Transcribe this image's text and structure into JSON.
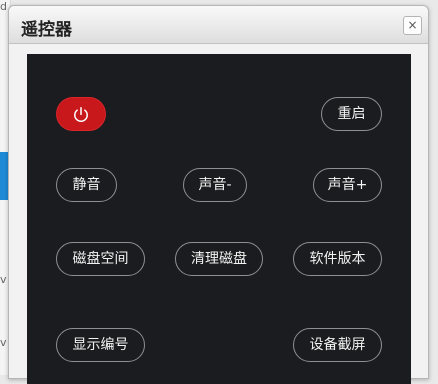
{
  "window": {
    "title": "遥控器",
    "close_label": "×"
  },
  "background": {
    "fragments": [
      "d",
      "v",
      "v"
    ]
  },
  "remote": {
    "power_icon": "power-icon",
    "power_color": "#c8181c",
    "panel_color": "#1b1c1f",
    "buttons": {
      "restart": "重启",
      "mute": "静音",
      "volume_down": "声音-",
      "volume_up": "声音+",
      "disk_space": "磁盘空间",
      "clean_disk": "清理磁盘",
      "software_version": "软件版本",
      "show_id": "显示编号",
      "screenshot": "设备截屏"
    }
  }
}
